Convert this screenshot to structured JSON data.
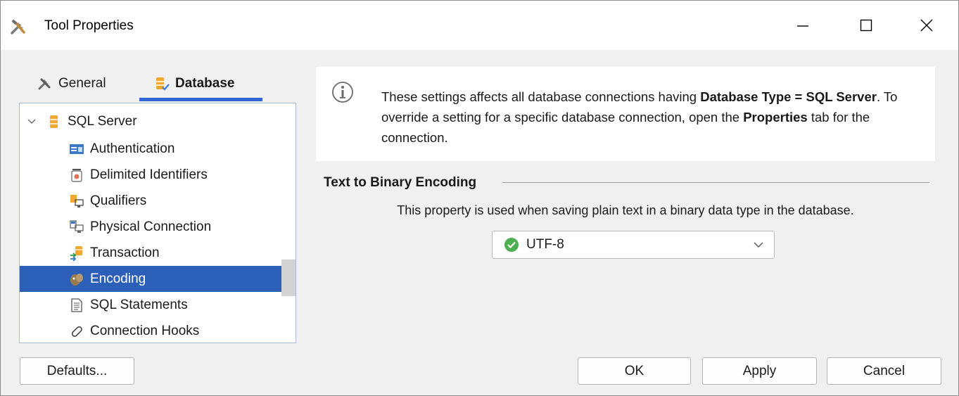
{
  "window": {
    "title": "Tool Properties",
    "title_icon": "tools-icon",
    "controls": [
      "minimize",
      "maximize",
      "close"
    ]
  },
  "tabs": [
    {
      "label": "General",
      "icon": "tools-icon",
      "active": false
    },
    {
      "label": "Database",
      "icon": "database-icon",
      "active": true
    }
  ],
  "tree": {
    "root": {
      "label": "SQL Server",
      "icon": "database-icon",
      "expanded": true
    },
    "items": [
      {
        "label": "Authentication",
        "icon": "authentication-icon",
        "selected": false
      },
      {
        "label": "Delimited Identifiers",
        "icon": "delimiter-icon",
        "selected": false
      },
      {
        "label": "Qualifiers",
        "icon": "qualifiers-icon",
        "selected": false
      },
      {
        "label": "Physical Connection",
        "icon": "physical-connection-icon",
        "selected": false
      },
      {
        "label": "Transaction",
        "icon": "transaction-icon",
        "selected": false
      },
      {
        "label": "Encoding",
        "icon": "encoding-icon",
        "selected": true
      },
      {
        "label": "SQL Statements",
        "icon": "document-icon",
        "selected": false
      },
      {
        "label": "Connection Hooks",
        "icon": "hook-icon",
        "selected": false
      }
    ]
  },
  "info": {
    "icon": "info-icon",
    "text_1": "These settings affects all database connections having ",
    "bold_1": "Database Type = SQL Server",
    "text_2": ". To override a setting for a specific database connection, open the ",
    "bold_2": "Properties",
    "text_3": " tab for the connection."
  },
  "encoding_group": {
    "title": "Text to Binary Encoding",
    "description": "This property is used when saving plain text in a binary data type in the database.",
    "selected_value": "UTF-8",
    "value_icon": "check-circle-icon"
  },
  "buttons": {
    "defaults": "Defaults...",
    "ok": "OK",
    "apply": "Apply",
    "cancel": "Cancel"
  },
  "colors": {
    "accent": "#2f67d4",
    "selection": "#2b5fb8",
    "check_green": "#4caf50"
  }
}
